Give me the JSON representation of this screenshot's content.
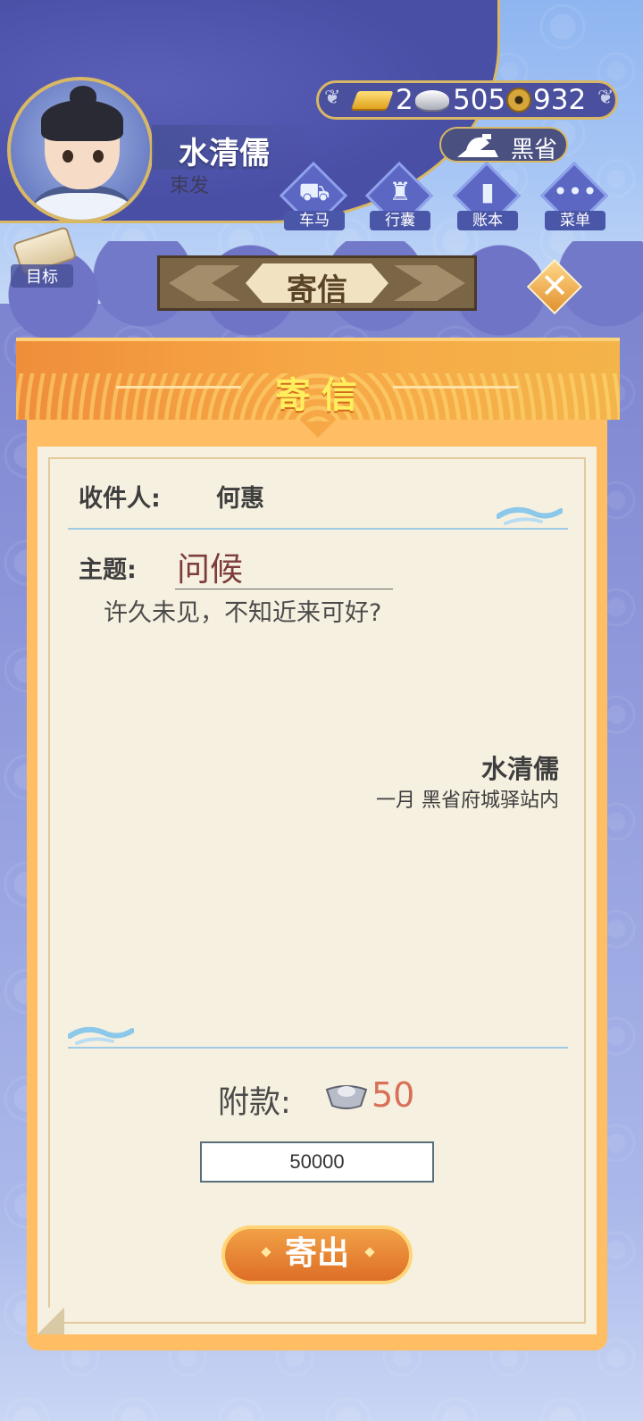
{
  "player": {
    "name": "水清儒",
    "title": "束发"
  },
  "currency": {
    "gold": "2",
    "silver": "505",
    "coins": "932"
  },
  "province": {
    "name": "黑省",
    "icon": "iron-icon"
  },
  "menu": [
    {
      "label": "车马",
      "icon": "carriage-icon"
    },
    {
      "label": "行囊",
      "icon": "bundle-icon"
    },
    {
      "label": "账本",
      "icon": "ledger-icon"
    },
    {
      "label": "菜单",
      "icon": "more-icon"
    }
  ],
  "goal": {
    "label": "目标"
  },
  "page": {
    "title": "寄信"
  },
  "letter": {
    "header": "寄信",
    "recipient_label": "收件人:",
    "recipient": "何惠",
    "subject_label": "主题:",
    "subject": "问候",
    "body": "许久未见，不知近来可好?",
    "signature": "水清儒",
    "sign_place": "一月 黑省府城驿站内"
  },
  "payment": {
    "label": "附款:",
    "amount": "50",
    "icon": "silver-ingot-icon",
    "input_value": "50000"
  },
  "send_button": {
    "label": "寄出"
  },
  "colors": {
    "accent": "#ef8e3a",
    "banner": "#4a4fa6",
    "subject": "#7d3c3c",
    "payment": "#d87058"
  }
}
